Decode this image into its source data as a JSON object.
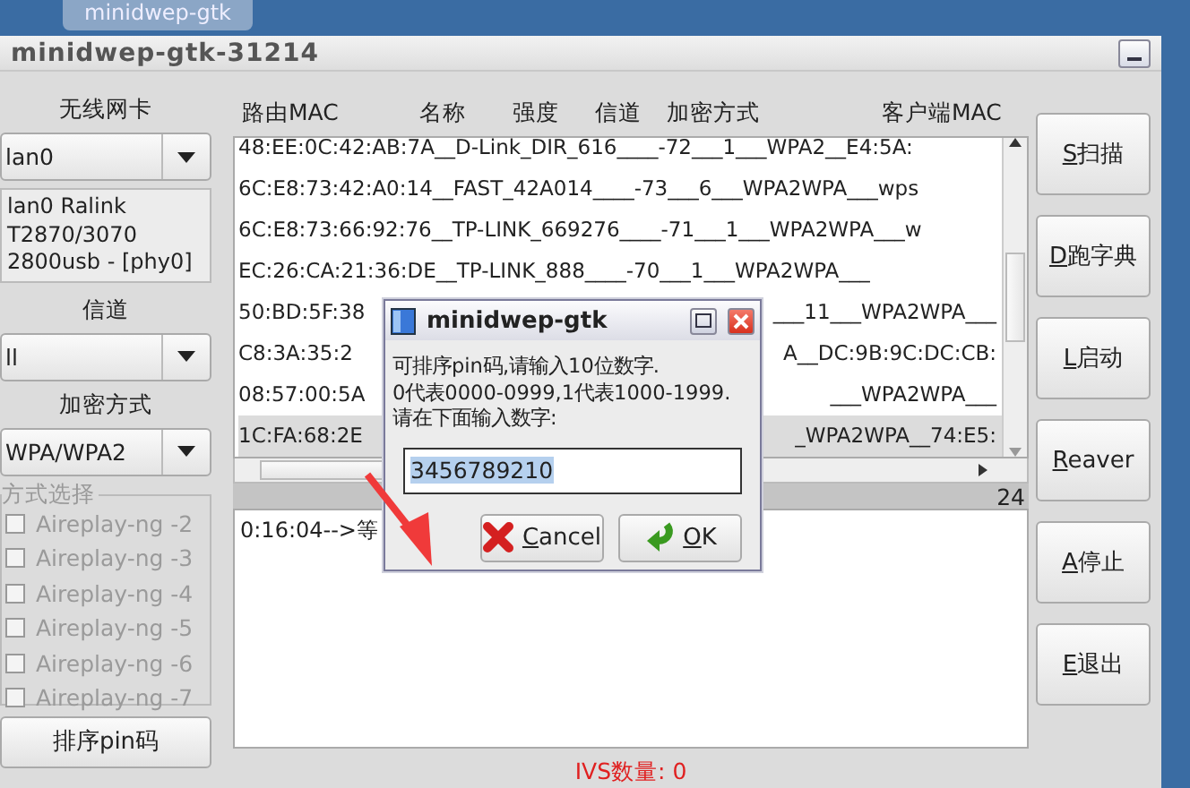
{
  "taskbar": {
    "tab": "minidwep-gtk"
  },
  "window": {
    "title": "minidwep-gtk-31214"
  },
  "left_panel": {
    "wireless_card_label": "无线网卡",
    "wireless_card": "lan0",
    "card_info": [
      "lan0 Ralink",
      "T2870/3070",
      "2800usb - [phy0]"
    ],
    "channel_label": "信道",
    "channel": "ll",
    "encryption_label": "加密方式",
    "encryption": "WPA/WPA2",
    "mode_group": {
      "title": "方式选择",
      "options": [
        {
          "label": "Aireplay-ng -2",
          "checked": false,
          "disabled": true
        },
        {
          "label": "Aireplay-ng -3",
          "checked": false,
          "disabled": true
        },
        {
          "label": "Aireplay-ng -4",
          "checked": false,
          "disabled": true
        },
        {
          "label": "Aireplay-ng -5",
          "checked": false,
          "disabled": true
        },
        {
          "label": "Aireplay-ng -6",
          "checked": false,
          "disabled": true
        },
        {
          "label": "Aireplay-ng -7",
          "checked": false,
          "disabled": true
        }
      ]
    },
    "sort_pin_button": "排序pin码"
  },
  "ap_list": {
    "columns": [
      "路由MAC",
      "名称",
      "强度",
      "信道",
      "加密方式",
      "客户端MAC"
    ],
    "rows": [
      {
        "segments": [
          "48:EE:0C:42:AB:7A__D-Link_DIR_616____-72___1___WPA2__E4:5A:"
        ],
        "selected": false
      },
      {
        "segments": [
          "6C:E8:73:42:A0:14__FAST_42A014____-73___6___WPA2WPA___wps"
        ],
        "selected": false
      },
      {
        "segments": [
          "6C:E8:73:66:92:76__TP-LINK_669276____-71___1___WPA2WPA___w"
        ],
        "selected": false
      },
      {
        "segments": [
          "EC:26:CA:21:36:DE__TP-LINK_888____-70___1___WPA2WPA___"
        ],
        "selected": false
      },
      {
        "segments": [
          "50:BD:5F:38",
          "___11___WPA2WPA___"
        ],
        "selected": false
      },
      {
        "segments": [
          "C8:3A:35:2",
          "A__DC:9B:9C:DC:CB:"
        ],
        "selected": false
      },
      {
        "segments": [
          "08:57:00:5A",
          "___WPA2WPA___"
        ],
        "selected": false
      },
      {
        "segments": [
          "1C:FA:68:2E",
          "_WPA2WPA__74:E5:"
        ],
        "selected": true
      }
    ],
    "count": "24"
  },
  "log": {
    "lines": [
      "0:16:04-->等"
    ]
  },
  "ivs_status": "IVS数量: 0",
  "actions": [
    "S扫描",
    "D跑字典",
    "L启动",
    "Reaver",
    "A停止",
    "E退出"
  ],
  "dialog": {
    "title": "minidwep-gtk",
    "message": [
      "可排序pin码,请输入10位数字.",
      "0代表0000-0999,1代表1000-1999.",
      "请在下面输入数字:"
    ],
    "input": {
      "value": "3456789210",
      "selected": true
    },
    "buttons": [
      {
        "label": "Cancel",
        "kind": "cancel"
      },
      {
        "label": "OK",
        "kind": "ok"
      }
    ]
  }
}
